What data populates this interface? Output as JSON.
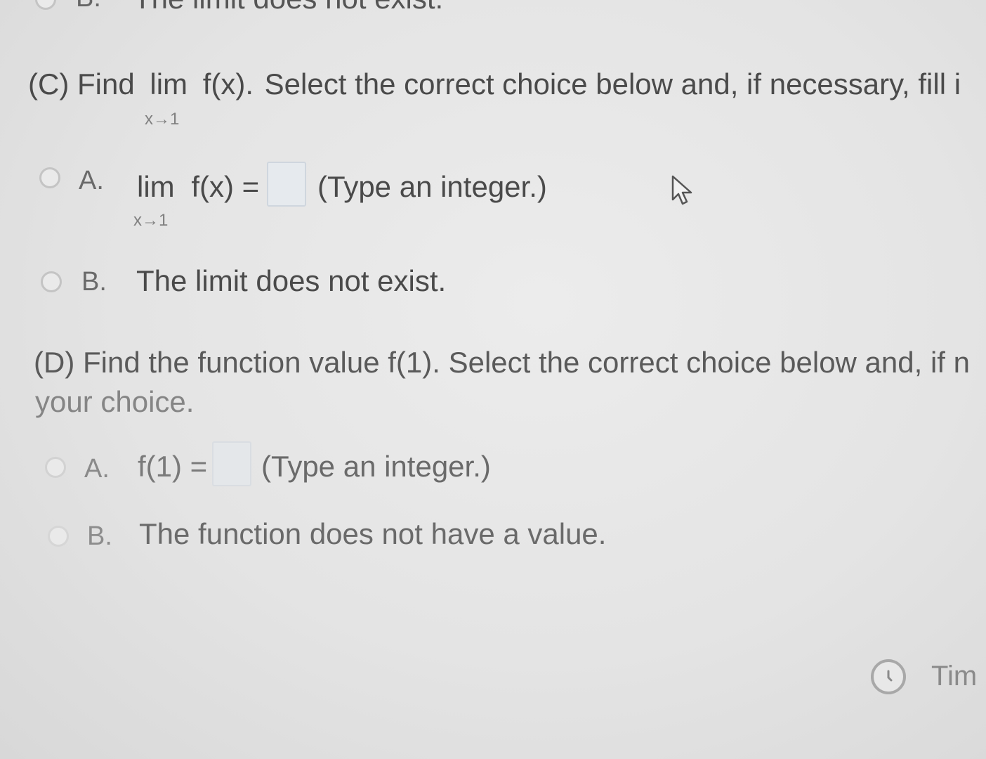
{
  "previous_choice": {
    "letter": "B.",
    "text": "The limit does not exist."
  },
  "part_c": {
    "prefix": "(C) Find",
    "lim": "lim",
    "func": "f(x).",
    "rest": "Select the correct choice below and, if necessary, fill i",
    "limit_sub": "x→1",
    "choice_a": {
      "letter": "A.",
      "lim": "lim",
      "expr": "f(x) =",
      "sub": "x→1",
      "answer_value": "",
      "hint": "(Type an integer.)"
    },
    "choice_b": {
      "letter": "B.",
      "text": "The limit does not exist."
    }
  },
  "part_d": {
    "question_line1": "(D) Find the function value f(1). Select the correct choice below and, if n",
    "question_line2": "your choice.",
    "choice_a": {
      "letter": "A.",
      "expr": "f(1) =",
      "answer_value": "",
      "hint": "(Type an integer.)"
    },
    "choice_b": {
      "letter": "B.",
      "text": "The function does not have a value."
    }
  },
  "timer": {
    "icon": "clock-icon",
    "label": "Tim"
  },
  "cursor": {
    "icon": "mouse-pointer-icon"
  }
}
